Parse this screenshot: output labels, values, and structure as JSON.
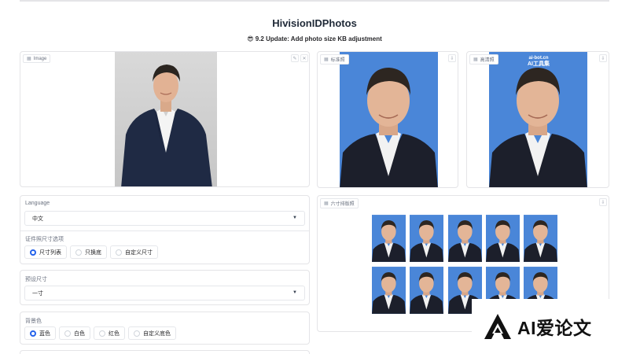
{
  "app": {
    "title": "HivisionIDPhotos",
    "update_icon": "sunglasses-emoji",
    "update_notice": "😎 9.2 Update: Add photo size KB adjustment"
  },
  "input_panel": {
    "label": "Image",
    "actions": [
      "edit-icon",
      "close-icon"
    ]
  },
  "outputs": {
    "standard_label": "标准照",
    "hd_label": "高清照",
    "layout_label": "六寸排版照",
    "hd_watermark": [
      "ai-bot.cn",
      "AI工具集"
    ],
    "layout_grid": {
      "rows": 2,
      "cols": 5
    },
    "download_icon": "download-icon"
  },
  "language": {
    "label": "Language",
    "value": "中文"
  },
  "size_mode": {
    "label": "证件照尺寸选项",
    "options": [
      "尺寸列表",
      "只换底",
      "自定义尺寸"
    ],
    "selected_index": 0
  },
  "preset_size": {
    "label": "预设尺寸",
    "value": "一寸"
  },
  "background": {
    "label": "背景色",
    "options": [
      "蓝色",
      "白色",
      "红色",
      "自定义底色"
    ],
    "selected_index": 0
  },
  "colors": {
    "accent": "#2563eb",
    "photo_blue": "#4a86d8",
    "border": "#e4e4e7"
  },
  "watermark": {
    "text": "AI爱论文"
  }
}
